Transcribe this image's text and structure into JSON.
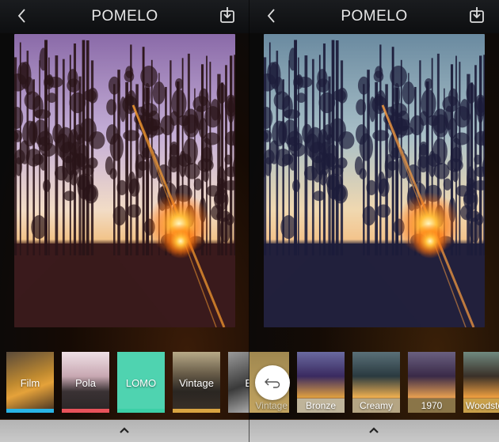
{
  "app": {
    "title": "POMELO"
  },
  "left": {
    "header": {
      "title": "POMELO",
      "back_icon": "chevron-left-icon",
      "save_icon": "download-tray-icon"
    },
    "photo": {
      "description": "Forest road at sunset with pine tree silhouettes and lens flare",
      "filter": "warm-purple"
    },
    "filter_categories": [
      {
        "label": "Film",
        "accent": "#29b4e6",
        "thumb_colors": [
          "#4a3a2a",
          "#e2a02a"
        ]
      },
      {
        "label": "Pola",
        "accent": "#e8525a",
        "thumb_colors": [
          "#e9d6de",
          "#2a2526"
        ]
      },
      {
        "label": "LOMO",
        "accent": "#3ccfa6",
        "thumb_colors": [
          "#4fd3b0",
          "#3ccfa6"
        ]
      },
      {
        "label": "Vintage",
        "accent": "#d9a441",
        "thumb_colors": [
          "#8a7a60",
          "#2a2622"
        ]
      },
      {
        "label": "B&",
        "accent": "#777777",
        "thumb_colors": [
          "#cfcfcf",
          "#3a3a3a"
        ]
      }
    ],
    "bottom": {
      "icon": "chevron-up-icon"
    }
  },
  "right": {
    "header": {
      "title": "POMELO",
      "back_icon": "chevron-left-icon",
      "save_icon": "download-tray-icon"
    },
    "photo": {
      "description": "Forest road at sunset with pine tree silhouettes, blue cool filter",
      "filter": "cool-blue"
    },
    "filters": [
      {
        "label": "Vintage",
        "selected": true,
        "label_bg": "#b99a55"
      },
      {
        "label": "Bronze",
        "label_bg": "#bfb49a"
      },
      {
        "label": "Creamy",
        "label_bg": "#b5a583"
      },
      {
        "label": "1970",
        "label_bg": "#8a7548"
      },
      {
        "label": "Woodstoc",
        "label_bg": "#c9a04a"
      }
    ],
    "undo_icon": "undo-arrow-icon",
    "bottom": {
      "icon": "chevron-up-icon"
    }
  }
}
